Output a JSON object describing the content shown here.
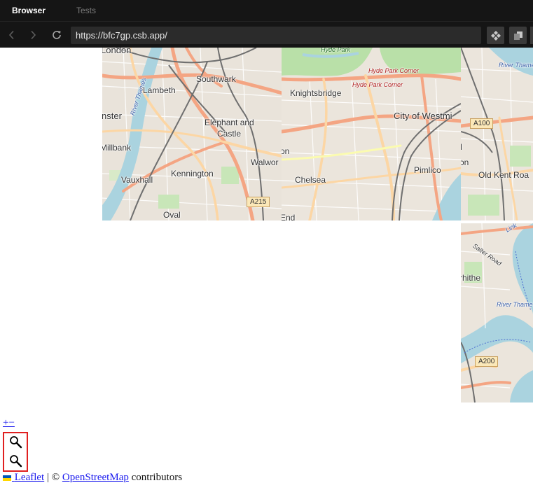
{
  "browser": {
    "tabs": [
      {
        "label": "Browser",
        "active": true
      },
      {
        "label": "Tests",
        "active": false
      }
    ],
    "url": "https://bfc7gp.csb.app/",
    "icons": {
      "back": "chevron-left-icon",
      "forward": "chevron-right-icon",
      "reload": "reload-icon",
      "devtools": "diamond-arrows-icon",
      "open_window": "window-stack-icon"
    }
  },
  "map": {
    "tiles": {
      "southwark": {
        "labels": {
          "london": "London",
          "southwark": "Southwark",
          "lambeth": "Lambeth",
          "nster": "nster",
          "elephant": "Elephant and",
          "castle": "Castle",
          "millbank": "Millbank",
          "walwor": "Walwor",
          "kennington": "Kennington",
          "vauxhall": "Vauxhall",
          "oval": "Oval",
          "river": "River Thames",
          "a215": "A215"
        }
      },
      "westminster": {
        "labels": {
          "hyde_park": "Hyde Park",
          "hyde_park_corner_1": "Hyde Park Corner",
          "hyde_park_corner_2": "Hyde Park Corner",
          "knightsbridge": "Knightsbridge",
          "city": "City of Westmi",
          "on": "on",
          "chelsea": "Chelsea",
          "pimlico": "Pimlico",
          "end": "End"
        }
      },
      "bermondsey": {
        "labels": {
          "river": "River Thame",
          "a100": "A100",
          "m": "M",
          "on": "on",
          "old_kent": "Old Kent Roa"
        }
      },
      "rotherhithe": {
        "labels": {
          "link": "Link",
          "salter": "Salter Road",
          "rhithe": "rhithe",
          "river": "River Thame",
          "a200": "A200"
        }
      }
    }
  },
  "leaflet": {
    "zoom_text": "+−",
    "search_icons": [
      "search-icon",
      "search-icon"
    ],
    "attribution": {
      "leaflet": "Leaflet",
      "sep": " | © ",
      "osm": "OpenStreetMap",
      "suffix": " contributors"
    }
  }
}
